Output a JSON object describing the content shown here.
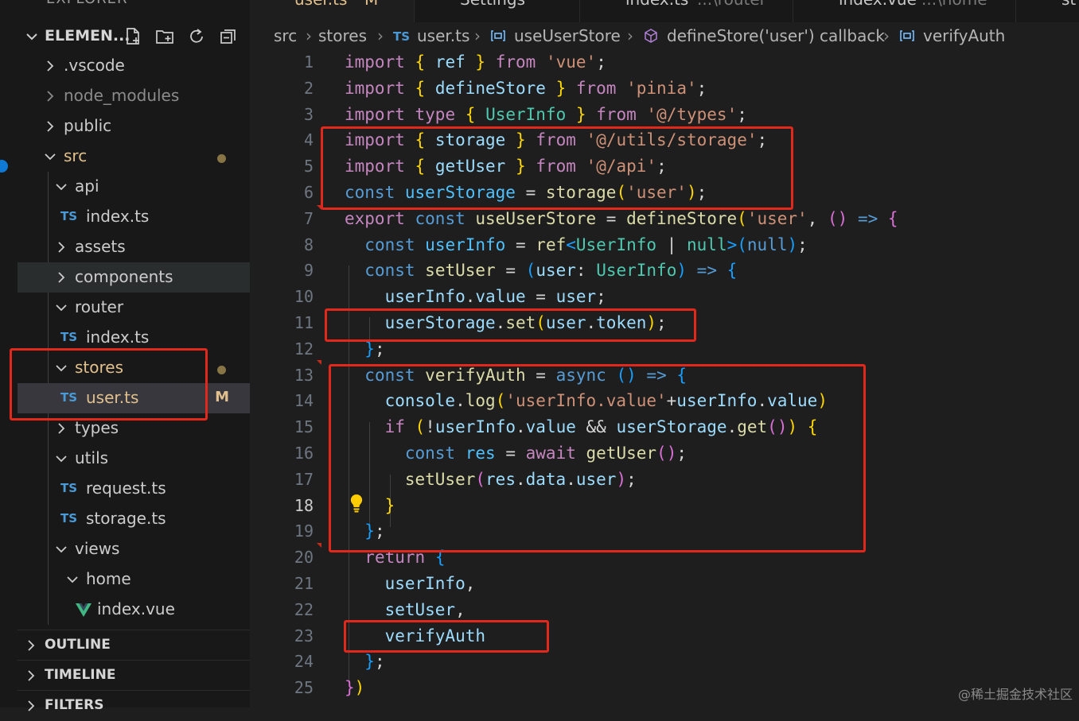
{
  "explorer_title": "EXPLORER",
  "tabs": [
    {
      "label": "user.ts",
      "suffix": "M",
      "active": true
    },
    {
      "label": "Settings",
      "suffix": "",
      "active": false
    },
    {
      "label": "index.ts",
      "suffix": "...\\router",
      "active": false
    },
    {
      "label": "index.vue",
      "suffix": "...\\home",
      "active": false
    },
    {
      "label": "st",
      "suffix": "",
      "active": false
    }
  ],
  "sidebar": {
    "project_title": "ELEMEN...",
    "actions": [
      "new-file-icon",
      "new-folder-icon",
      "refresh-icon",
      "collapse-all-icon"
    ],
    "tree": [
      {
        "name": ".vscode",
        "kind": "folder",
        "open": false
      },
      {
        "name": "node_modules",
        "kind": "folder",
        "open": false
      },
      {
        "name": "public",
        "kind": "folder",
        "open": false
      },
      {
        "name": "src",
        "kind": "folder",
        "open": true
      },
      {
        "name": "api",
        "kind": "folder",
        "open": true
      },
      {
        "name": "index.ts",
        "kind": "ts"
      },
      {
        "name": "assets",
        "kind": "folder",
        "open": false
      },
      {
        "name": "components",
        "kind": "folder",
        "open": false
      },
      {
        "name": "router",
        "kind": "folder",
        "open": true
      },
      {
        "name": "index.ts",
        "kind": "ts"
      },
      {
        "name": "stores",
        "kind": "folder",
        "open": true
      },
      {
        "name": "user.ts",
        "kind": "ts",
        "badge": "M"
      },
      {
        "name": "types",
        "kind": "folder",
        "open": false
      },
      {
        "name": "utils",
        "kind": "folder",
        "open": true
      },
      {
        "name": "request.ts",
        "kind": "ts"
      },
      {
        "name": "storage.ts",
        "kind": "ts"
      },
      {
        "name": "views",
        "kind": "folder",
        "open": true
      },
      {
        "name": "home",
        "kind": "folder",
        "open": true
      },
      {
        "name": "index.vue",
        "kind": "vue"
      }
    ],
    "sections": [
      "OUTLINE",
      "TIMELINE",
      "FILTERS"
    ]
  },
  "breadcrumb": {
    "src": "src",
    "stores": "stores",
    "ts_badge": "TS",
    "file": "user.ts",
    "hook": "useUserStore",
    "callback": "defineStore('user') callback",
    "symbol": "verifyAuth"
  },
  "editor": {
    "line_numbers": [
      "1",
      "2",
      "3",
      "4",
      "5",
      "6",
      "7",
      "8",
      "9",
      "10",
      "11",
      "12",
      "13",
      "14",
      "15",
      "16",
      "17",
      "18",
      "19",
      "20",
      "21",
      "22",
      "23",
      "24",
      "25"
    ],
    "current_line": "18",
    "code": {
      "l1": [
        "import",
        "{",
        "ref",
        "}",
        "from",
        "'vue'",
        ";"
      ],
      "l2": [
        "import",
        "{",
        "defineStore",
        "}",
        "from",
        "'pinia'",
        ";"
      ],
      "l3": [
        "import",
        "type",
        "{",
        "UserInfo",
        "}",
        "from",
        "'@/types'",
        ";"
      ],
      "l4": [
        "import",
        "{",
        "storage",
        "}",
        "from",
        "'@/utils/storage'",
        ";"
      ],
      "l5": [
        "import",
        "{",
        "getUser",
        "}",
        "from",
        "'@/api'",
        ";"
      ],
      "l6": [
        "const",
        "userStorage",
        "=",
        "storage",
        "(",
        "'user'",
        ")",
        ";"
      ],
      "l7": [
        "export",
        "const",
        "useUserStore",
        "=",
        "defineStore",
        "(",
        "'user'",
        ",",
        "(",
        ")",
        "=>",
        "{"
      ],
      "l8": [
        "const",
        "userInfo",
        "=",
        "ref",
        "<",
        "UserInfo",
        "|",
        "null",
        ">",
        "(",
        "null",
        ")",
        ";"
      ],
      "l9": [
        "const",
        "setUser",
        "=",
        "(",
        "user",
        ":",
        "UserInfo",
        ")",
        "=>",
        "{"
      ],
      "l10": [
        "userInfo",
        ".",
        "value",
        "=",
        "user",
        ";"
      ],
      "l11": [
        "userStorage",
        ".",
        "set",
        "(",
        "user",
        ".",
        "token",
        ")",
        ";"
      ],
      "l12": [
        "}",
        ";"
      ],
      "l13": [
        "const",
        "verifyAuth",
        "=",
        "async",
        "(",
        ")",
        "=>",
        "{"
      ],
      "l14": [
        "console",
        ".",
        "log",
        "(",
        "'userInfo.value'",
        "+",
        "userInfo",
        ".",
        "value",
        ")"
      ],
      "l15": [
        "if",
        "(",
        "!",
        "userInfo",
        ".",
        "value",
        "&&",
        "userStorage",
        ".",
        "get",
        "(",
        ")",
        ")",
        "{"
      ],
      "l16": [
        "const",
        "res",
        "=",
        "await",
        "getUser",
        "(",
        ")",
        ";"
      ],
      "l17": [
        "setUser",
        "(",
        "res",
        ".",
        "data",
        ".",
        "user",
        ")",
        ";"
      ],
      "l18": [
        "}"
      ],
      "l19": [
        "}",
        ";"
      ],
      "l20": [
        "return",
        "{"
      ],
      "l21": [
        "userInfo",
        ","
      ],
      "l22": [
        "setUser",
        ","
      ],
      "l23": [
        "verifyAuth"
      ],
      "l24": [
        "}",
        ";"
      ],
      "l25": [
        "}",
        ")"
      ]
    }
  },
  "watermark": "@稀土掘金技术社区",
  "colors": {
    "annotation": "#e0281c",
    "modified": "#e2c08d",
    "keyword_control": "#c586c0",
    "keyword_storage": "#569cd6",
    "function": "#dcdcaa",
    "variable": "#9cdcfe",
    "constant": "#4fc1ff",
    "type": "#4ec9b0",
    "string": "#ce9178"
  }
}
